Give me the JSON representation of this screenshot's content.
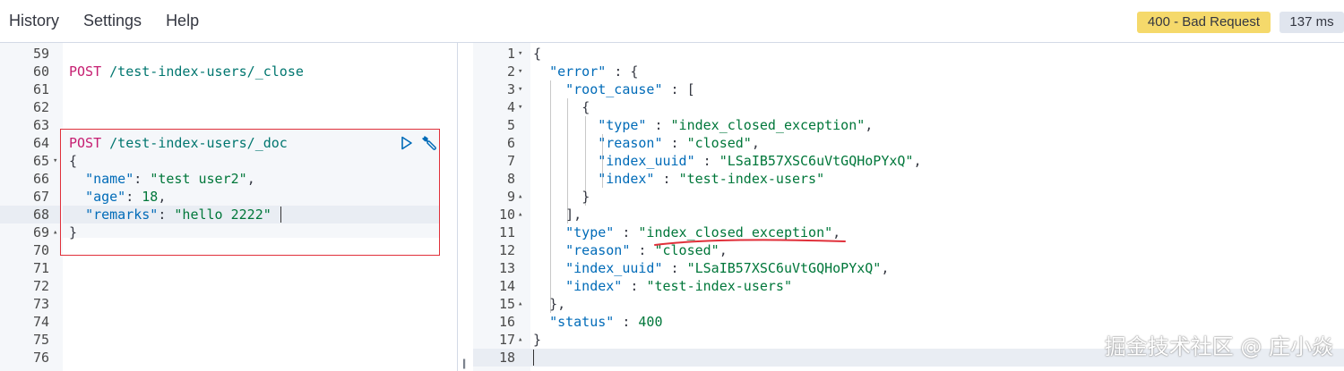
{
  "menu": {
    "history": "History",
    "settings": "Settings",
    "help": "Help"
  },
  "response_status": "400 - Bad Request",
  "response_time": "137 ms",
  "request_lines": [
    {
      "n": "59",
      "text": ""
    },
    {
      "n": "60",
      "text": "POST /test-index-users/_close"
    },
    {
      "n": "61",
      "text": ""
    },
    {
      "n": "62",
      "text": ""
    },
    {
      "n": "63",
      "text": ""
    },
    {
      "n": "64",
      "text": "POST /test-index-users/_doc"
    },
    {
      "n": "65",
      "text": "{"
    },
    {
      "n": "66",
      "text": "  \"name\": \"test user2\","
    },
    {
      "n": "67",
      "text": "  \"age\": 18,"
    },
    {
      "n": "68",
      "text": "  \"remarks\": \"hello 2222\""
    },
    {
      "n": "69",
      "text": "}"
    },
    {
      "n": "70",
      "text": ""
    },
    {
      "n": "71",
      "text": ""
    },
    {
      "n": "72",
      "text": ""
    },
    {
      "n": "73",
      "text": ""
    },
    {
      "n": "74",
      "text": ""
    },
    {
      "n": "75",
      "text": ""
    },
    {
      "n": "76",
      "text": ""
    }
  ],
  "response_lines": [
    {
      "n": "1",
      "text": "{"
    },
    {
      "n": "2",
      "text": "  \"error\" : {"
    },
    {
      "n": "3",
      "text": "    \"root_cause\" : ["
    },
    {
      "n": "4",
      "text": "      {"
    },
    {
      "n": "5",
      "text": "        \"type\" : \"index_closed_exception\","
    },
    {
      "n": "6",
      "text": "        \"reason\" : \"closed\","
    },
    {
      "n": "7",
      "text": "        \"index_uuid\" : \"LSaIB57XSC6uVtGQHoPYxQ\","
    },
    {
      "n": "8",
      "text": "        \"index\" : \"test-index-users\""
    },
    {
      "n": "9",
      "text": "      }"
    },
    {
      "n": "10",
      "text": "    ],"
    },
    {
      "n": "11",
      "text": "    \"type\" : \"index_closed_exception\","
    },
    {
      "n": "12",
      "text": "    \"reason\" : \"closed\","
    },
    {
      "n": "13",
      "text": "    \"index_uuid\" : \"LSaIB57XSC6uVtGQHoPYxQ\","
    },
    {
      "n": "14",
      "text": "    \"index\" : \"test-index-users\""
    },
    {
      "n": "15",
      "text": "  },"
    },
    {
      "n": "16",
      "text": "  \"status\" : 400"
    },
    {
      "n": "17",
      "text": "}"
    },
    {
      "n": "18",
      "text": ""
    }
  ],
  "icons": {
    "run": "play-icon",
    "settings": "wrench-icon"
  },
  "watermark": "掘金技术社区 @ 庄小焱",
  "colors": {
    "status_bg": "#f5d96b",
    "time_bg": "#e0e5ee",
    "selection_border": "#e0303a",
    "keyword": "#c61e71",
    "key": "#006bb8",
    "string": "#00773a"
  }
}
